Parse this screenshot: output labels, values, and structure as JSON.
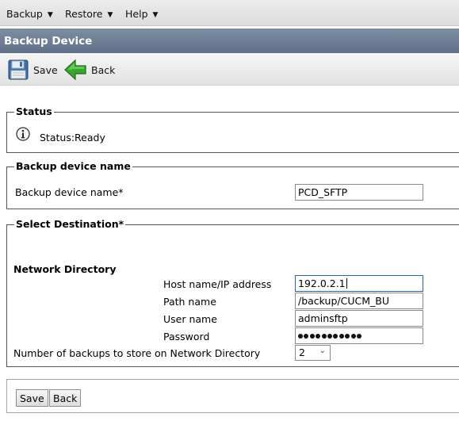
{
  "menu": {
    "backup": "Backup",
    "restore": "Restore",
    "help": "Help"
  },
  "page_title": "Backup Device",
  "toolbar": {
    "save_label": "Save",
    "back_label": "Back"
  },
  "status": {
    "legend": "Status",
    "text": "Status:Ready"
  },
  "device": {
    "legend": "Backup device name",
    "label": "Backup device name*",
    "value": "PCD_SFTP"
  },
  "destination": {
    "legend": "Select Destination*",
    "section_title": "Network Directory",
    "host_label": "Host name/IP address",
    "host_value": "192.0.2.1",
    "path_label": "Path name",
    "path_value": "/backup/CUCM_BU",
    "user_label": "User name",
    "user_value": "adminsftp",
    "password_label": "Password",
    "password_masked_length": 11,
    "backups_label": "Number of backups to store on Network Directory",
    "backups_value": "2"
  },
  "buttons": {
    "save": "Save",
    "back": "Back"
  },
  "icons": {
    "save": "floppy-disk-icon",
    "back": "green-left-arrow-icon",
    "info": "info-icon"
  },
  "colors": {
    "title_bar": "#6b7b92",
    "back_arrow": "#3aa52e"
  }
}
